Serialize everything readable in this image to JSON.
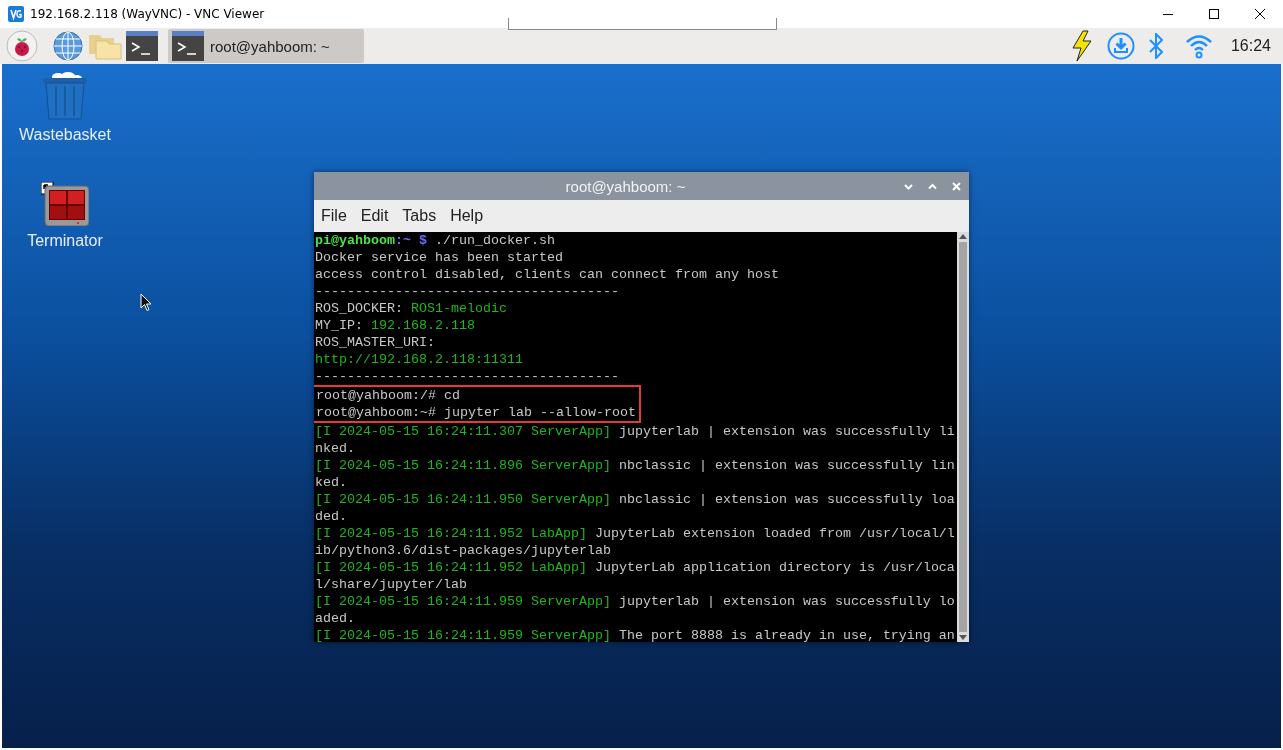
{
  "viewer": {
    "title": "192.168.2.118 (WayVNC) - VNC Viewer"
  },
  "panel": {
    "tasks": [
      {
        "label": "root@yahboom: ~",
        "selected": true
      }
    ],
    "clock": "16:24"
  },
  "desktop_icons": [
    {
      "kind": "wastebasket",
      "label": "Wastebasket"
    },
    {
      "kind": "terminator",
      "label": "Terminator"
    }
  ],
  "terminal": {
    "title": "root@yahboom: ~",
    "menu": [
      "File",
      "Edit",
      "Tabs",
      "Help"
    ],
    "lines": [
      {
        "highlighted": false,
        "segments": [
          {
            "kind": "user",
            "text": "pi@yahboom"
          },
          {
            "kind": "path",
            "text": ":~ $"
          },
          {
            "kind": "plain",
            "text": " ./run_docker.sh"
          }
        ]
      },
      {
        "highlighted": false,
        "segments": [
          {
            "kind": "plain",
            "text": "Docker service has been started"
          }
        ]
      },
      {
        "highlighted": false,
        "segments": [
          {
            "kind": "plain",
            "text": "access control disabled, clients can connect from any host"
          }
        ]
      },
      {
        "highlighted": false,
        "segments": [
          {
            "kind": "plain",
            "text": "--------------------------------------"
          }
        ]
      },
      {
        "highlighted": false,
        "segments": [
          {
            "kind": "plain",
            "text": "ROS_DOCKER: "
          },
          {
            "kind": "green",
            "text": "ROS1-melodic"
          }
        ]
      },
      {
        "highlighted": false,
        "segments": [
          {
            "kind": "plain",
            "text": "MY_IP: "
          },
          {
            "kind": "green",
            "text": "192.168.2.118"
          }
        ]
      },
      {
        "highlighted": false,
        "segments": [
          {
            "kind": "plain",
            "text": "ROS_MASTER_URI:"
          }
        ]
      },
      {
        "highlighted": false,
        "segments": [
          {
            "kind": "green",
            "text": "http://192.168.2.118:11311"
          }
        ]
      },
      {
        "highlighted": false,
        "segments": [
          {
            "kind": "plain",
            "text": "--------------------------------------"
          }
        ]
      },
      {
        "highlighted": true,
        "segments": [
          {
            "kind": "plain",
            "text": "root@yahboom:/# cd"
          }
        ]
      },
      {
        "highlighted": true,
        "segments": [
          {
            "kind": "plain",
            "text": "root@yahboom:~# jupyter lab --allow-root"
          }
        ]
      },
      {
        "highlighted": false,
        "segments": [
          {
            "kind": "green",
            "text": "[I 2024-05-15 16:24:11.307 ServerApp]"
          },
          {
            "kind": "plain",
            "text": " jupyterlab | extension was successfully li"
          }
        ]
      },
      {
        "highlighted": false,
        "segments": [
          {
            "kind": "plain",
            "text": "nked."
          }
        ]
      },
      {
        "highlighted": false,
        "segments": [
          {
            "kind": "green",
            "text": "[I 2024-05-15 16:24:11.896 ServerApp]"
          },
          {
            "kind": "plain",
            "text": " nbclassic | extension was successfully lin"
          }
        ]
      },
      {
        "highlighted": false,
        "segments": [
          {
            "kind": "plain",
            "text": "ked."
          }
        ]
      },
      {
        "highlighted": false,
        "segments": [
          {
            "kind": "green",
            "text": "[I 2024-05-15 16:24:11.950 ServerApp]"
          },
          {
            "kind": "plain",
            "text": " nbclassic | extension was successfully loa"
          }
        ]
      },
      {
        "highlighted": false,
        "segments": [
          {
            "kind": "plain",
            "text": "ded."
          }
        ]
      },
      {
        "highlighted": false,
        "segments": [
          {
            "kind": "green",
            "text": "[I 2024-05-15 16:24:11.952 LabApp]"
          },
          {
            "kind": "plain",
            "text": " JupyterLab extension loaded from /usr/local/l"
          }
        ]
      },
      {
        "highlighted": false,
        "segments": [
          {
            "kind": "plain",
            "text": "ib/python3.6/dist-packages/jupyterlab"
          }
        ]
      },
      {
        "highlighted": false,
        "segments": [
          {
            "kind": "green",
            "text": "[I 2024-05-15 16:24:11.952 LabApp]"
          },
          {
            "kind": "plain",
            "text": " JupyterLab application directory is /usr/loca"
          }
        ]
      },
      {
        "highlighted": false,
        "segments": [
          {
            "kind": "plain",
            "text": "l/share/jupyter/lab"
          }
        ]
      },
      {
        "highlighted": false,
        "segments": [
          {
            "kind": "green",
            "text": "[I 2024-05-15 16:24:11.959 ServerApp]"
          },
          {
            "kind": "plain",
            "text": " jupyterlab | extension was successfully lo"
          }
        ]
      },
      {
        "highlighted": false,
        "segments": [
          {
            "kind": "plain",
            "text": "aded."
          }
        ]
      },
      {
        "highlighted": false,
        "segments": [
          {
            "kind": "green",
            "text": "[I 2024-05-15 16:24:11.959 ServerApp]"
          },
          {
            "kind": "plain",
            "text": " The port 8888 is already in use, trying an"
          }
        ]
      }
    ]
  }
}
